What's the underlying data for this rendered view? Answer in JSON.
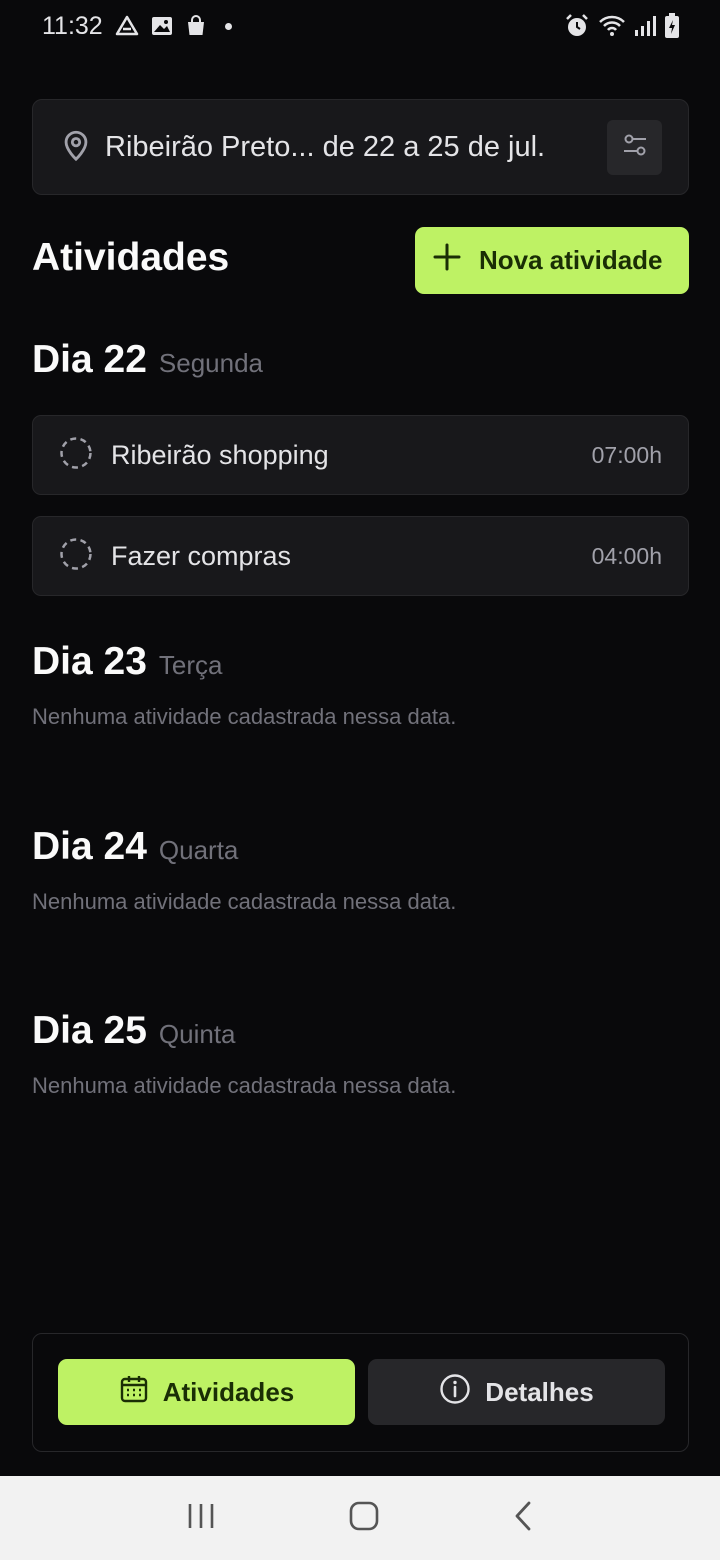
{
  "status_bar": {
    "time": "11:32"
  },
  "location_bar": {
    "text": "Ribeirão Preto... de 22 a 25 de jul."
  },
  "header": {
    "title": "Atividades",
    "new_button_label": "Nova atividade"
  },
  "days": [
    {
      "title": "Dia 22",
      "weekday": "Segunda",
      "activities": [
        {
          "name": "Ribeirão shopping",
          "time": "07:00h"
        },
        {
          "name": "Fazer compras",
          "time": "04:00h"
        }
      ]
    },
    {
      "title": "Dia 23",
      "weekday": "Terça",
      "empty_message": "Nenhuma atividade cadastrada nessa data."
    },
    {
      "title": "Dia 24",
      "weekday": "Quarta",
      "empty_message": "Nenhuma atividade cadastrada nessa data."
    },
    {
      "title": "Dia 25",
      "weekday": "Quinta",
      "empty_message": "Nenhuma atividade cadastrada nessa data."
    }
  ],
  "bottom_nav": {
    "activities_label": "Atividades",
    "details_label": "Detalhes"
  },
  "colors": {
    "accent": "#bef264",
    "background": "#09090b",
    "card": "#18181b"
  },
  "icons": {
    "location": "map-pin-icon",
    "settings": "sliders-icon",
    "add": "plus-icon",
    "activity_status": "dashed-circle-icon",
    "calendar": "calendar-icon",
    "info": "info-icon"
  }
}
